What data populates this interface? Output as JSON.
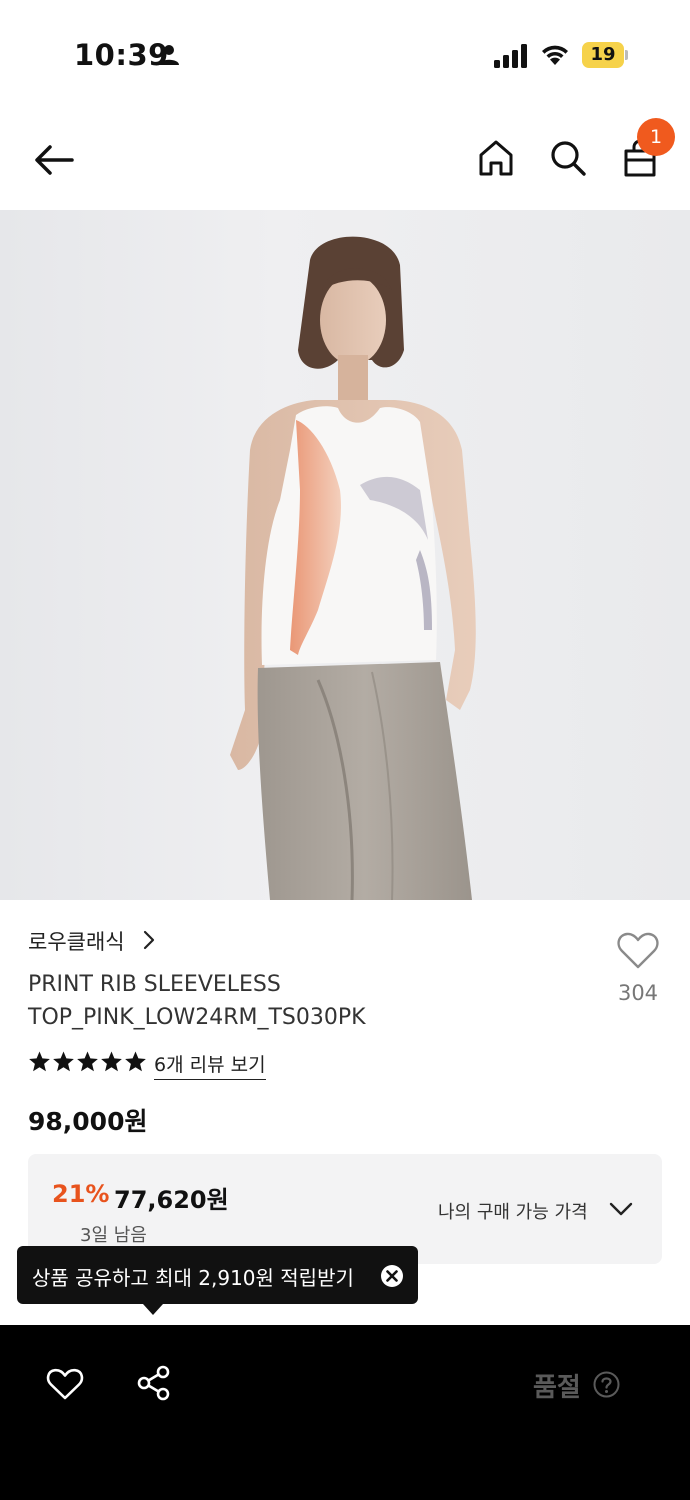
{
  "status_bar": {
    "time": "10:39",
    "battery": "19",
    "icons": [
      "person-icon",
      "signal-icon",
      "wifi-icon",
      "battery-icon"
    ]
  },
  "header": {
    "icons": [
      "back-arrow-icon",
      "home-icon",
      "search-icon",
      "shopping-bag-icon"
    ],
    "cart_badge": "1"
  },
  "product": {
    "brand": "로우클래식",
    "name_line1": "PRINT RIB SLEEVELESS",
    "name_line2": "TOP_PINK_LOW24RM_TS030PK",
    "wish_count": "304",
    "rating_stars": 5,
    "review_link": "6개 리뷰 보기",
    "price": "98,000원"
  },
  "discount": {
    "rate": "21%",
    "price": "77,620원",
    "days_left": "3일 남음",
    "my_price_label": "나의 구매 가능 가격"
  },
  "tooltip": {
    "text": "상품 공유하고 최대 2,910원 적립받기"
  },
  "bottom_bar": {
    "soldout_label": "품절",
    "icons": [
      "heart-icon",
      "share-icon",
      "help-icon"
    ]
  },
  "colors": {
    "accent": "#f05a1e",
    "discount": "#e8531d",
    "bottom_bar_bg": "#000000",
    "tooltip_bg": "#111111"
  }
}
